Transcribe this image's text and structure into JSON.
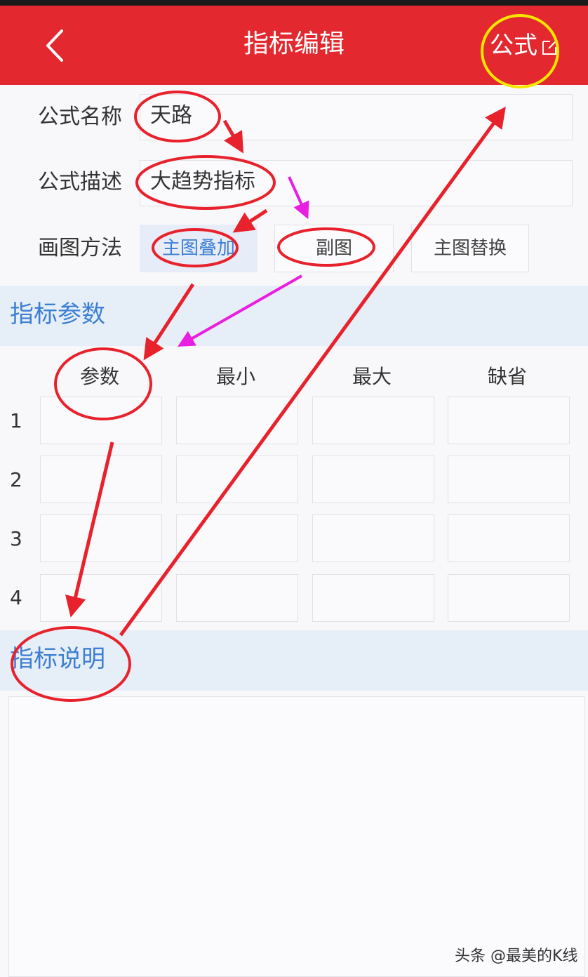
{
  "header": {
    "title": "指标编辑",
    "formula_label": "公式"
  },
  "form": {
    "name_label": "公式名称",
    "name_value": "天路",
    "desc_label": "公式描述",
    "desc_value": "大趋势指标",
    "draw_label": "画图方法",
    "draw_options": [
      "主图叠加",
      "副图",
      "主图替换"
    ],
    "draw_selected": "主图叠加"
  },
  "params": {
    "section_title": "指标参数",
    "columns": [
      "参数",
      "最小",
      "最大",
      "缺省"
    ],
    "rows": [
      "1",
      "2",
      "3",
      "4"
    ]
  },
  "explain": {
    "section_title": "指标说明"
  },
  "watermark": "头条 @最美的K线",
  "colors": {
    "header_bg": "#e3282f",
    "accent_blue": "#3d7fd3",
    "annotation_red": "#e8222c",
    "annotation_magenta": "#e81ee0",
    "annotation_yellow": "#f5e600"
  }
}
